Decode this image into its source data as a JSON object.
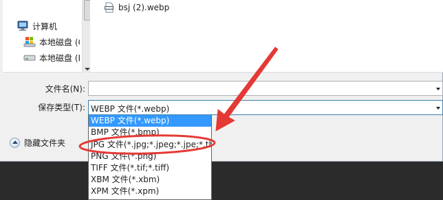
{
  "nav": {
    "items": [
      {
        "label": "计算机",
        "icon": "computer-icon"
      },
      {
        "label": "本地磁盘 (C",
        "icon": "local-disk-icon"
      },
      {
        "label": "本地磁盘 (D",
        "icon": "drive-icon"
      }
    ]
  },
  "file_list": {
    "items": [
      {
        "name": "bsj (2).webp",
        "icon": "webp-file-icon"
      }
    ]
  },
  "form": {
    "filename_label": "文件名(N):",
    "filename_value": "",
    "filetype_label": "保存类型(T):",
    "filetype_value": "WEBP 文件(*.webp)"
  },
  "hide_folders": {
    "label": "隐藏文件夹",
    "icon": "collapse-up-icon"
  },
  "dropdown": {
    "options": [
      {
        "label": "WEBP 文件(*.webp)",
        "selected": true
      },
      {
        "label": "BMP 文件(*.bmp)",
        "selected": false
      },
      {
        "label": "JPG 文件(*.jpg;*.jpeg;*.jpe;*.tbi)",
        "selected": false
      },
      {
        "label": "PNG 文件(*.png)",
        "selected": false
      },
      {
        "label": "TIFF 文件(*.tif;*.tiff)",
        "selected": false
      },
      {
        "label": "XBM 文件(*.xbm)",
        "selected": false
      },
      {
        "label": "XPM 文件(*.xpm)",
        "selected": false
      }
    ]
  },
  "annotation": {
    "color": "#e53935",
    "highlighted_option": "JPG 文件(*.jpg;*.jpeg;*.jpe;*.tbi)"
  },
  "colors": {
    "selection": "#3399ff",
    "dialog_bg": "#f0f0f0",
    "backdrop": "#2b2b2b"
  }
}
